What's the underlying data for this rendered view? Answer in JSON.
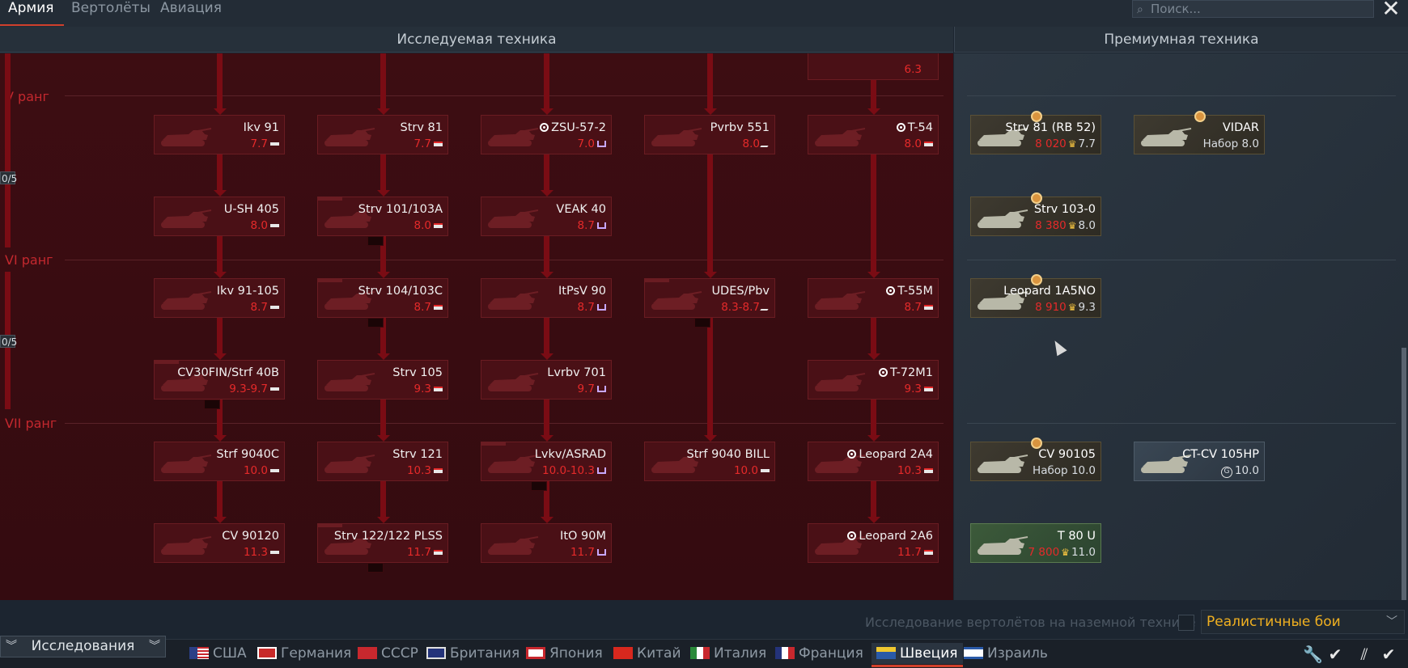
{
  "tabs": [
    "Армия",
    "Вертолёты",
    "Авиация"
  ],
  "search_placeholder": "Поиск...",
  "headers": {
    "researchable": "Исследуемая техника",
    "premium": "Премиумная техника"
  },
  "ranks": {
    "v": "V ранг",
    "vi": "VI ранг",
    "vii": "VII ранг"
  },
  "progress": {
    "v": "0/5",
    "vi": "0/5"
  },
  "top_partial_br": "6.3",
  "tree": {
    "row1": [
      {
        "name": "Ikv 91",
        "br": "7.7",
        "cls": "td"
      },
      {
        "name": "Strv 81",
        "br": "7.7",
        "cls": "mt"
      },
      {
        "name": "ZSU-57-2",
        "br": "7.0",
        "cls": "spaa",
        "captured": true
      },
      {
        "name": "Pvrbv 551",
        "br": "8.0",
        "cls": "atgm"
      },
      {
        "name": "T-54",
        "br": "8.0",
        "cls": "mt",
        "captured": true
      }
    ],
    "row2": [
      {
        "name": "U-SH 405",
        "br": "8.0",
        "cls": "td"
      },
      {
        "name": "Strv 101/103A",
        "br": "8.0",
        "cls": "mt"
      },
      {
        "name": "VEAK 40",
        "br": "8.7",
        "cls": "spaa"
      }
    ],
    "row3": [
      {
        "name": "Ikv 91-105",
        "br": "8.7",
        "cls": "td"
      },
      {
        "name": "Strv 104/103C",
        "br": "8.7",
        "cls": "mt"
      },
      {
        "name": "ItPsV 90",
        "br": "8.7",
        "cls": "spaa"
      },
      {
        "name": "UDES/Pbv",
        "br": "8.3-8.7",
        "cls": "atgm"
      },
      {
        "name": "T-55M",
        "br": "8.7",
        "cls": "mt",
        "captured": true
      }
    ],
    "row4": [
      {
        "name": "CV30FIN/Strf 40B",
        "br": "9.3-9.7",
        "cls": "td"
      },
      {
        "name": "Strv 105",
        "br": "9.3",
        "cls": "mt"
      },
      {
        "name": "Lvrbv 701",
        "br": "9.7",
        "cls": "spaa"
      },
      {
        "name": "T-72M1",
        "br": "9.3",
        "cls": "mt",
        "captured": true
      }
    ],
    "row5": [
      {
        "name": "Strf 9040C",
        "br": "10.0",
        "cls": "td"
      },
      {
        "name": "Strv 121",
        "br": "10.3",
        "cls": "mt"
      },
      {
        "name": "Lvkv/ASRAD",
        "br": "10.0-10.3",
        "cls": "spaa"
      },
      {
        "name": "Strf 9040 BILL",
        "br": "10.0",
        "cls": "td"
      },
      {
        "name": "Leopard 2A4",
        "br": "10.3",
        "cls": "mt",
        "captured": true
      }
    ],
    "row6": [
      {
        "name": "CV 90120",
        "br": "11.3",
        "cls": "td"
      },
      {
        "name": "Strv 122/122 PLSS",
        "br": "11.7",
        "cls": "mt"
      },
      {
        "name": "ItO 90M",
        "br": "11.7",
        "cls": "spaa"
      },
      {
        "name": "Leopard 2A6",
        "br": "11.7",
        "cls": "mt",
        "captured": true
      }
    ]
  },
  "premium": [
    {
      "name": "Strv 81 (RB 52)",
      "cost": "8 020",
      "br": "7.7"
    },
    {
      "name": "VIDAR",
      "prefix": "Набор",
      "br": "8.0"
    },
    {
      "name": "Strv 103-0",
      "cost": "8 380",
      "br": "8.0"
    },
    {
      "name": "Leopard 1A5NO",
      "cost": "8 910",
      "br": "9.3"
    },
    {
      "name": "CV 90105",
      "prefix": "Набор",
      "br": "10.0"
    },
    {
      "name": "CT-CV 105HP",
      "br": "10.0",
      "badge": "G"
    },
    {
      "name": "T 80 U",
      "cost": "7 800",
      "br": "11.0"
    }
  ],
  "bottom": {
    "heli_toggle": "Исследование вертолётов на наземной технике",
    "mode": "Реалистичные бои",
    "research": "Исследования"
  },
  "nations": [
    "США",
    "Германия",
    "СССР",
    "Британия",
    "Япония",
    "Китай",
    "Италия",
    "Франция",
    "Швеция",
    "Израиль"
  ],
  "colors": {
    "accent": "#d0402c",
    "br_red": "#e52a2a",
    "mode_gold": "#f0b020",
    "tree_bg": "#3d0d12"
  }
}
